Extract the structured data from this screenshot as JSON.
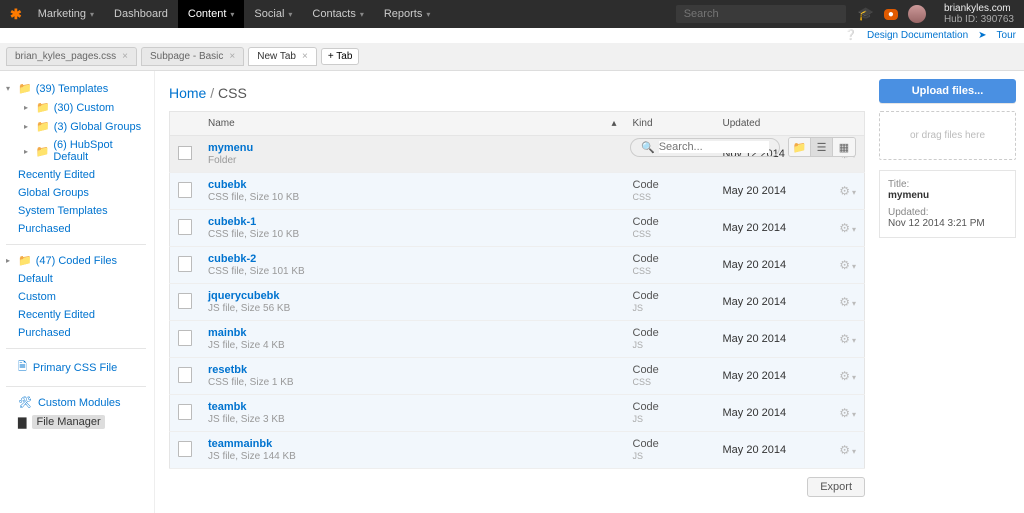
{
  "topnav": {
    "brand": "Marketing",
    "items": [
      "Dashboard",
      "Content",
      "Social",
      "Contacts",
      "Reports"
    ],
    "active_index": 1,
    "search_placeholder": "Search",
    "user_domain": "briankyles.com",
    "user_hub": "Hub ID: 390763"
  },
  "metalinks": {
    "design_doc": "Design Documentation",
    "tour": "Tour"
  },
  "tabs": {
    "items": [
      {
        "label": "brian_kyles_pages.css",
        "active": false
      },
      {
        "label": "Subpage - Basic",
        "active": false
      },
      {
        "label": "New Tab",
        "active": true
      }
    ],
    "add_label": "+ Tab"
  },
  "sidebar": {
    "templates_root": "(39) Templates",
    "templates_children": [
      "(30) Custom",
      "(3) Global Groups",
      "(6) HubSpot Default"
    ],
    "templates_links": [
      "Recently Edited",
      "Global Groups",
      "System Templates",
      "Purchased"
    ],
    "coded_root": "(47) Coded Files",
    "coded_links": [
      "Default",
      "Custom",
      "Recently Edited",
      "Purchased"
    ],
    "primary_css": "Primary CSS File",
    "custom_modules": "Custom Modules",
    "file_manager": "File Manager"
  },
  "breadcrumb": {
    "home": "Home",
    "current": "CSS"
  },
  "search": {
    "placeholder": "Search..."
  },
  "upload": {
    "button": "Upload files...",
    "dropzone": "or drag files here"
  },
  "table": {
    "headers": {
      "name": "Name",
      "kind": "Kind",
      "updated": "Updated"
    },
    "rows": [
      {
        "name": "mymenu",
        "meta": "Folder",
        "kind": "",
        "kindsub": "",
        "updated": "Nov 12 2014",
        "selected": true,
        "is_folder": true
      },
      {
        "name": "cubebk",
        "meta": "CSS file, Size 10 KB",
        "kind": "Code",
        "kindsub": "CSS",
        "updated": "May 20 2014"
      },
      {
        "name": "cubebk-1",
        "meta": "CSS file, Size 10 KB",
        "kind": "Code",
        "kindsub": "CSS",
        "updated": "May 20 2014"
      },
      {
        "name": "cubebk-2",
        "meta": "CSS file, Size 101 KB",
        "kind": "Code",
        "kindsub": "CSS",
        "updated": "May 20 2014"
      },
      {
        "name": "jquerycubebk",
        "meta": "JS file, Size 56 KB",
        "kind": "Code",
        "kindsub": "JS",
        "updated": "May 20 2014"
      },
      {
        "name": "mainbk",
        "meta": "JS file, Size 4 KB",
        "kind": "Code",
        "kindsub": "JS",
        "updated": "May 20 2014"
      },
      {
        "name": "resetbk",
        "meta": "CSS file, Size 1 KB",
        "kind": "Code",
        "kindsub": "CSS",
        "updated": "May 20 2014"
      },
      {
        "name": "teambk",
        "meta": "JS file, Size 3 KB",
        "kind": "Code",
        "kindsub": "JS",
        "updated": "May 20 2014"
      },
      {
        "name": "teammainbk",
        "meta": "JS file, Size 144 KB",
        "kind": "Code",
        "kindsub": "JS",
        "updated": "May 20 2014"
      }
    ]
  },
  "export_label": "Export",
  "detail": {
    "title_label": "Title:",
    "title_value": "mymenu",
    "updated_label": "Updated:",
    "updated_value": "Nov 12 2014 3:21 PM"
  }
}
